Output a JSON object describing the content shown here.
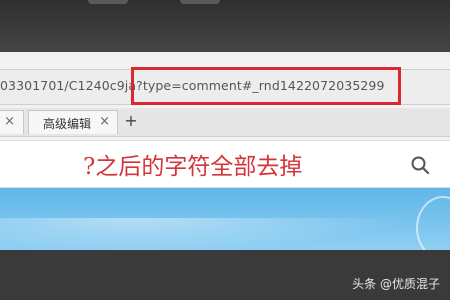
{
  "address_bar": {
    "url": "03301701/C1240c9ja?type=comment#_rnd1422072035299"
  },
  "tabs": {
    "left_close": "×",
    "items": [
      {
        "label": "高级编辑",
        "close": "×"
      }
    ],
    "new_tab": "+"
  },
  "search": {
    "annotation": "?之后的字符全部去掉",
    "icon": "search-icon"
  },
  "watermark": {
    "text": "头条 @优质混子"
  },
  "colors": {
    "highlight": "#d9282f",
    "annotation": "#d6333b",
    "content_blue": "#5fb6e8"
  }
}
